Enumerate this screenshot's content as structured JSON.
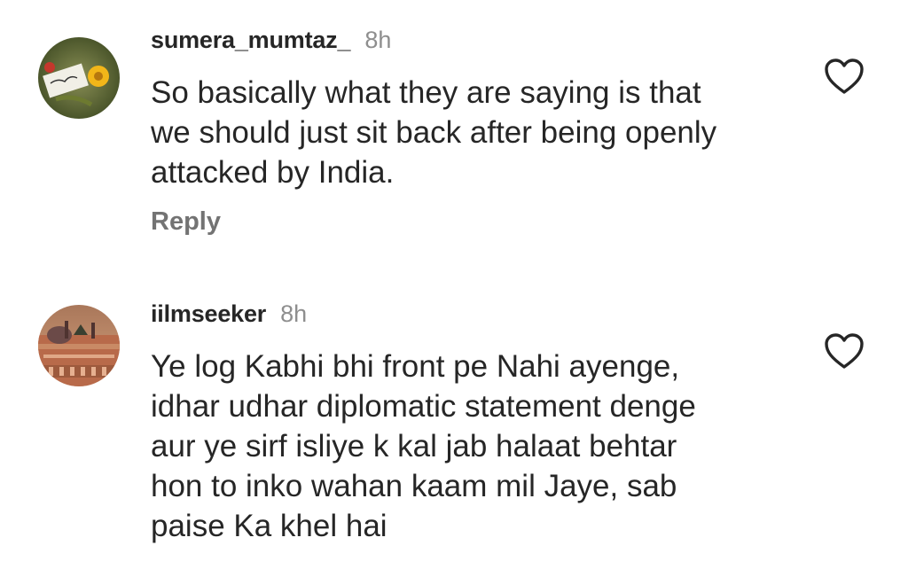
{
  "comments": [
    {
      "username": "sumera_mumtaz_",
      "time": "8h",
      "text": [
        "So basically what they are saying is that",
        "we should just sit back after being openly",
        "attacked by India."
      ],
      "reply_label": "Reply",
      "avatar_icon": "calligraphy-flower-avatar",
      "like_icon": "heart-outline-icon"
    },
    {
      "username": "iilmseeker",
      "time": "8h",
      "text": [
        "Ye log Kabhi bhi front pe Nahi ayenge,",
        "idhar udhar diplomatic statement denge",
        "aur ye sirf isliye k kal jab halaat behtar",
        "hon to inko wahan kaam mil Jaye, sab",
        "paise Ka khel hai"
      ],
      "avatar_icon": "mosque-avatar",
      "like_icon": "heart-outline-icon"
    }
  ],
  "colors": {
    "text": "#262626",
    "secondary": "#8e8e8e",
    "reply": "#737373"
  }
}
